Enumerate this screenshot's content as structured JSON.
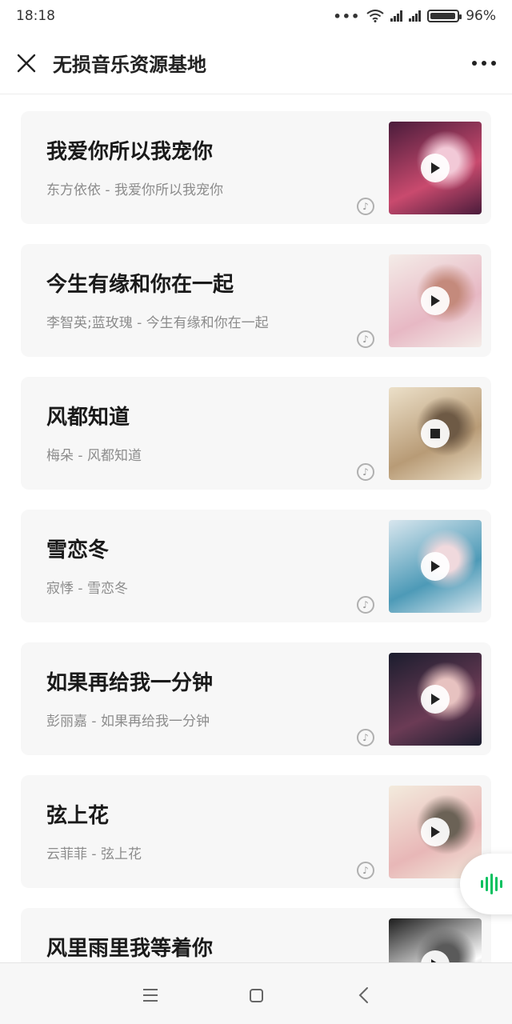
{
  "status": {
    "time": "18:18",
    "battery": "96%",
    "battery_level": 0.96
  },
  "header": {
    "title": "无损音乐资源基地"
  },
  "songs": [
    {
      "title": "我爱你所以我宠你",
      "subtitle": "东方依依 - 我爱你所以我宠你",
      "state": "play",
      "cover_colors": [
        "#4a1c3b",
        "#c94a6e",
        "#f2c9d7"
      ]
    },
    {
      "title": "今生有缘和你在一起",
      "subtitle": "李智英;蓝玫瑰 - 今生有缘和你在一起",
      "state": "play",
      "cover_colors": [
        "#f4ece8",
        "#e7b8c4",
        "#c48a7c"
      ]
    },
    {
      "title": "风都知道",
      "subtitle": "梅朵 - 风都知道",
      "state": "stop",
      "cover_colors": [
        "#ece0c9",
        "#b89b76",
        "#6e5a45"
      ]
    },
    {
      "title": "雪恋冬",
      "subtitle": "寂悸 - 雪恋冬",
      "state": "play",
      "cover_colors": [
        "#d8e6ee",
        "#4d9ab7",
        "#f0d9dd"
      ]
    },
    {
      "title": "如果再给我一分钟",
      "subtitle": "彭丽嘉 - 如果再给我一分钟",
      "state": "play",
      "cover_colors": [
        "#1b1d2e",
        "#6b3b55",
        "#e7c2c0"
      ]
    },
    {
      "title": "弦上花",
      "subtitle": "云菲菲 - 弦上花",
      "state": "play",
      "cover_colors": [
        "#f3ebdd",
        "#e8b7b7",
        "#6b6256"
      ]
    },
    {
      "title": "风里雨里我等着你",
      "subtitle": "",
      "state": "play",
      "cover_colors": [
        "#1d1d1d",
        "#ffffff",
        "#5a5a5a"
      ]
    }
  ],
  "icons": {
    "close": "close-icon",
    "more": "more-icon",
    "play": "play-icon",
    "stop": "stop-icon",
    "music": "music-note-icon",
    "wave": "voice-wave-icon",
    "nav_menu": "menu-icon",
    "nav_home": "home-icon",
    "nav_back": "back-icon"
  }
}
